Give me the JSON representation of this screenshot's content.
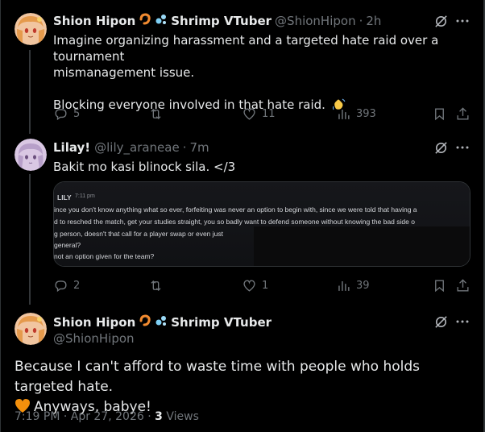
{
  "post1": {
    "name": "Shion Hipon",
    "name_suffix": "Shrimp VTuber",
    "handle": "@ShionHipon",
    "time": "2h",
    "text_line1": "Imagine organizing harassment and a targeted hate raid over a tournament",
    "text_line2": "mismanagement issue.",
    "text_line3": "Blocking everyone involved in that hate raid.",
    "replies": "5",
    "likes": "11",
    "views": "393"
  },
  "post2": {
    "name": "Lilay!",
    "handle": "@lily_araneae",
    "time": "7m",
    "text": "Bakit mo kasi blinock sila. </3",
    "embed": {
      "author": "LILY",
      "time": "7:11 pm",
      "line1": "ince you don't know anything what so ever, forfeiting was never an option to begin with, since we were told that having a",
      "line2": "d to resched the match, get your studies straight, you so badly want to defend someone without knowing the bad side o",
      "line3": "g person, doesn't that call for a player swap or even just",
      "line4": "general?",
      "line5": "not an option given for the team?"
    },
    "replies": "2",
    "likes": "1",
    "views": "39"
  },
  "post3": {
    "name": "Shion Hipon",
    "name_suffix": "Shrimp VTuber",
    "handle": "@ShionHipon",
    "text_line1": "Because I can't afford to waste time with people who holds targeted hate.",
    "text_line2": "Anyways, babye!",
    "time": "7:19 PM · Apr 27, 2026 ·",
    "views_count": "3",
    "views_label": "Views"
  },
  "colors": {
    "bg": "#000000",
    "text": "#e7e9ea",
    "muted": "#71767b",
    "border": "#2f3336",
    "heart": "#f4900c"
  },
  "icons": [
    "shrimp-icon",
    "bubbles-icon",
    "grok-icon",
    "more-icon",
    "reply-icon",
    "retweet-icon",
    "like-icon",
    "views-icon",
    "bookmark-icon",
    "share-icon",
    "wave-icon",
    "orange-heart-icon"
  ]
}
